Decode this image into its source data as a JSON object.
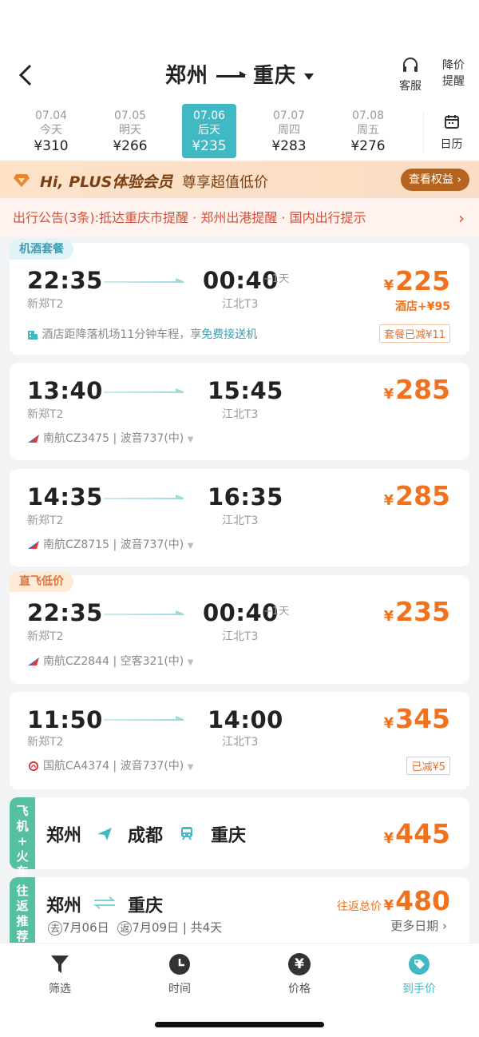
{
  "header": {
    "from": "郑州",
    "to": "重庆",
    "service_label": "客服",
    "alert_label_1": "降价",
    "alert_label_2": "提醒",
    "calendar_label": "日历"
  },
  "dates": [
    {
      "date": "07.04",
      "weekday": "今天",
      "price": "¥310"
    },
    {
      "date": "07.05",
      "weekday": "明天",
      "price": "¥266"
    },
    {
      "date": "07.06",
      "weekday": "后天",
      "price": "¥235",
      "selected": true
    },
    {
      "date": "07.07",
      "weekday": "周四",
      "price": "¥283"
    },
    {
      "date": "07.08",
      "weekday": "周五",
      "price": "¥276"
    }
  ],
  "plus": {
    "title": "Hi, PLUS体验会员",
    "subtitle": "尊享超值低价",
    "button": "查看权益"
  },
  "notice": {
    "text": "出行公告(3条):抵达重庆市提醒 · 郑州出港提醒 · 国内出行提示"
  },
  "flights": [
    {
      "tag": "机酒套餐",
      "dep": "22:35",
      "dep_ap": "新郑T2",
      "arr": "00:40",
      "plus": "+1天",
      "arr_ap": "江北T3",
      "price": "225",
      "extra": "酒店+¥95",
      "info": "酒店距降落机场11分钟车程，享",
      "info_hl": "免费接送机",
      "badge": "套餐已减¥11"
    },
    {
      "dep": "13:40",
      "dep_ap": "新郑T2",
      "arr": "15:45",
      "arr_ap": "江北T3",
      "price": "285",
      "info": "南航CZ3475 | 波音737(中)"
    },
    {
      "dep": "14:35",
      "dep_ap": "新郑T2",
      "arr": "16:35",
      "arr_ap": "江北T3",
      "price": "285",
      "info": "南航CZ8715 | 波音737(中)"
    },
    {
      "tag": "直飞低价",
      "dep": "22:35",
      "dep_ap": "新郑T2",
      "arr": "00:40",
      "plus": "+1天",
      "arr_ap": "江北T3",
      "price": "235",
      "info": "南航CZ2844 | 空客321(中)"
    },
    {
      "dep": "11:50",
      "dep_ap": "新郑T2",
      "arr": "14:00",
      "arr_ap": "江北T3",
      "price": "345",
      "info": "国航CA4374 | 波音737(中)",
      "badge": "已减¥5"
    }
  ],
  "combo": {
    "side": [
      "飞",
      "机",
      "+",
      "火",
      "车"
    ],
    "from": "郑州",
    "via": "成都",
    "to": "重庆",
    "price": "445"
  },
  "roundtrip": {
    "side": [
      "往",
      "返",
      "推",
      "荐"
    ],
    "from": "郑州",
    "to": "重庆",
    "go_mark": "去",
    "go_date": "7月06日",
    "back_mark": "返",
    "back_date": "7月09日",
    "duration": "| 共4天",
    "total_label": "往返总价",
    "price": "480",
    "more": "更多日期 ›"
  },
  "tabs": [
    {
      "label": "筛选",
      "icon": "filter-icon"
    },
    {
      "label": "时间",
      "icon": "clock-icon"
    },
    {
      "label": "价格",
      "icon": "yen-icon"
    },
    {
      "label": "到手价",
      "icon": "tag-icon",
      "active": true
    }
  ],
  "colors": {
    "accent": "#41b9c5",
    "price": "#f2711c",
    "notice": "#d5513a"
  }
}
